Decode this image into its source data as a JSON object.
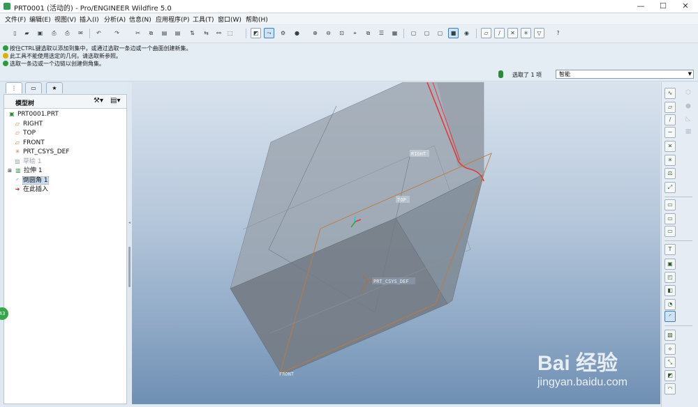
{
  "window": {
    "title": "PRT0001 (活动的) - Pro/ENGINEER Wildfire 5.0",
    "minimize": "—",
    "maximize": "☐",
    "close": "✕"
  },
  "menu": [
    "文件(F)",
    "编辑(E)",
    "视图(V)",
    "插入(I)",
    "分析(A)",
    "信息(N)",
    "应用程序(P)",
    "工具(T)",
    "窗口(W)",
    "帮助(H)"
  ],
  "messages": [
    {
      "text": "按住CTRL键选取以添加到集中，或通过选取一条边或一个曲面创建新集。",
      "icon": "info-arrow-icon",
      "color": "#2e9a3b"
    },
    {
      "text": "此工具不能使用选定的几何。请选取新参照。",
      "icon": "warning-icon",
      "color": "#e0b000"
    },
    {
      "text": "选取一条边或一个边链以创建倒角集。",
      "icon": "info-arrow-icon",
      "color": "#2e9a3b"
    }
  ],
  "selection": {
    "status": "选取了 1 项",
    "filter": "智能"
  },
  "tree": {
    "header": "模型树",
    "items": [
      {
        "label": "PRT0001.PRT",
        "icon": "part-icon",
        "state": "normal"
      },
      {
        "label": "RIGHT",
        "icon": "datum-plane-icon",
        "state": "normal"
      },
      {
        "label": "TOP",
        "icon": "datum-plane-icon",
        "state": "normal"
      },
      {
        "label": "FRONT",
        "icon": "datum-plane-icon",
        "state": "normal"
      },
      {
        "label": "PRT_CSYS_DEF",
        "icon": "csys-icon",
        "state": "normal"
      },
      {
        "label": "草绘 1",
        "icon": "sketch-icon",
        "state": "dim"
      },
      {
        "label": "拉伸 1",
        "icon": "extrude-icon",
        "state": "normal"
      },
      {
        "label": "倒圆角 1",
        "icon": "round-icon",
        "state": "selected"
      },
      {
        "label": "在此插入",
        "icon": "insert-here-arrow-icon",
        "state": "normal"
      }
    ]
  },
  "viewport": {
    "labels": [
      "RIGHT",
      "TOP",
      "FRONT",
      "PRT_CSYS_DEF"
    ]
  },
  "badge": "43",
  "watermark": {
    "brand": "Bai 经验",
    "url": "jingyan.baidu.com"
  },
  "colors": {
    "accent": "#3f7db8",
    "selected_edge": "#e23a3a",
    "datum_plane": "#c07a3c"
  }
}
